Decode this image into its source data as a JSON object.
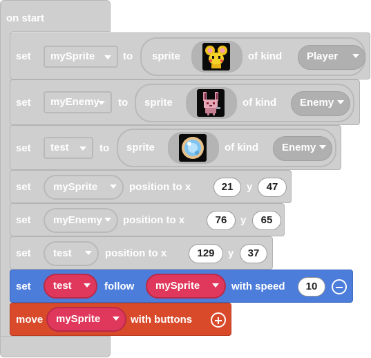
{
  "event": {
    "label": "on start"
  },
  "rows": [
    {
      "set_label": "set",
      "variable": "mySprite",
      "to_label": "to",
      "sprite_label": "sprite",
      "sprite_icon": "yellow-mouse-sprite-icon",
      "kind_label": "of kind",
      "kind": "Player"
    },
    {
      "set_label": "set",
      "variable": "myEnemy",
      "to_label": "to",
      "sprite_label": "sprite",
      "sprite_icon": "pink-bunny-sprite-icon",
      "kind_label": "of kind",
      "kind": "Enemy"
    },
    {
      "set_label": "set",
      "variable": "test",
      "to_label": "to",
      "sprite_label": "sprite",
      "sprite_icon": "blue-orb-sprite-icon",
      "kind_label": "of kind",
      "kind": "Enemy"
    }
  ],
  "positions": [
    {
      "set_label": "set",
      "variable": "mySprite",
      "pos_label": "position to x",
      "x": "21",
      "y_label": "y",
      "y": "47"
    },
    {
      "set_label": "set",
      "variable": "myEnemy",
      "pos_label": "position to x",
      "x": "76",
      "y_label": "y",
      "y": "65"
    },
    {
      "set_label": "set",
      "variable": "test",
      "pos_label": "position to x",
      "x": "129",
      "y_label": "y",
      "y": "37"
    }
  ],
  "follow": {
    "set_label": "set",
    "variable": "test",
    "follow_label": "follow",
    "target": "mySprite",
    "speed_label": "with speed",
    "speed": "10",
    "minus_icon": "minus-circle-icon"
  },
  "move": {
    "move_label": "move",
    "variable": "mySprite",
    "buttons_label": "with buttons",
    "plus_icon": "plus-circle-icon"
  },
  "colors": {
    "block_gray": "#cfcfcf",
    "sprites_blue": "#4c7ddb",
    "controller_red": "#d94a2b",
    "variable_pink": "#e0385c"
  }
}
